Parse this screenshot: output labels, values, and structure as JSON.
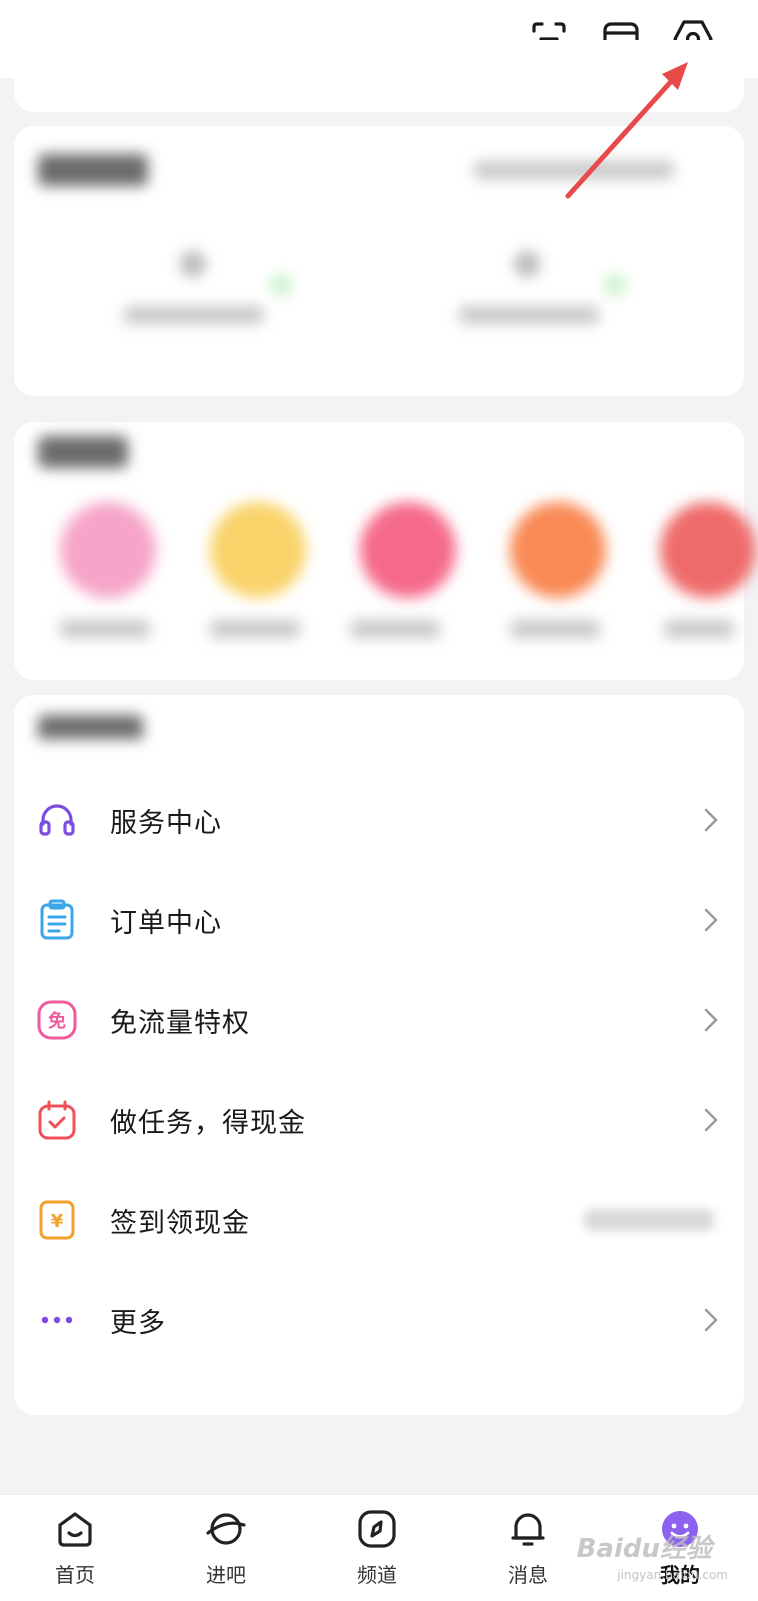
{
  "top_icons": [
    "scan-icon",
    "box-icon",
    "settings-icon"
  ],
  "services": {
    "items": [
      {
        "label": "服务中心",
        "icon": "headset-icon",
        "color": "#7b4de0"
      },
      {
        "label": "订单中心",
        "icon": "clipboard-icon",
        "color": "#3aa6e8"
      },
      {
        "label": "免流量特权",
        "icon": "free-badge-icon",
        "glyph": "免",
        "color": "#ef5b9a"
      },
      {
        "label": "做任务，得现金",
        "icon": "calendar-check-icon",
        "color": "#f0505a"
      },
      {
        "label": "签到领现金",
        "icon": "yen-icon",
        "glyph": "¥",
        "color": "#f3a02c"
      },
      {
        "label": "更多",
        "icon": "more-dots-icon",
        "color": "#7b4de0"
      }
    ]
  },
  "tabbar": {
    "tabs": [
      {
        "label": "首页",
        "icon": "home-icon"
      },
      {
        "label": "进吧",
        "icon": "planet-icon"
      },
      {
        "label": "频道",
        "icon": "compass-icon"
      },
      {
        "label": "消息",
        "icon": "bell-icon"
      },
      {
        "label": "我的",
        "icon": "profile-icon"
      }
    ],
    "active": "我的"
  },
  "watermark": {
    "text": "Baidu经验",
    "sub": "jingyan.baidu.com"
  },
  "colors": {
    "accent": "#7b4de0",
    "annotation_arrow": "#e84a4a"
  }
}
